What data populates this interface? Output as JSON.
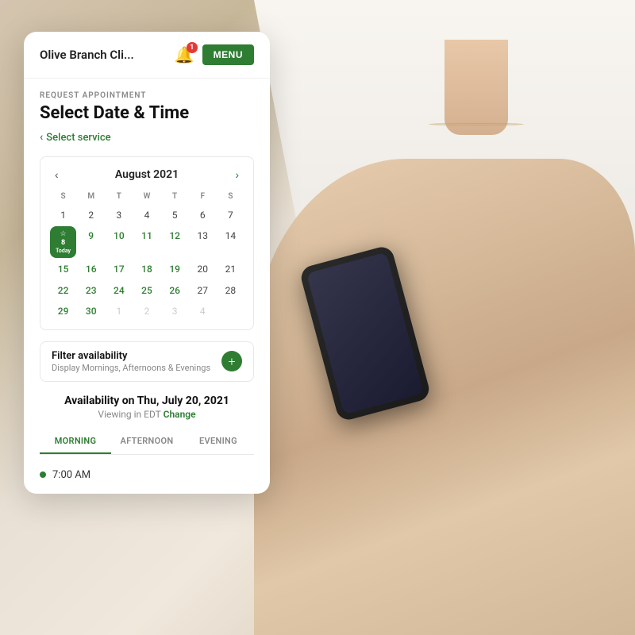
{
  "background": {
    "color1": "#d4c5b0",
    "color2": "#e8d8c4"
  },
  "header": {
    "brand": "Olive Branch Cli...",
    "notification_count": "1",
    "menu_label": "MENU"
  },
  "page": {
    "section_label": "REQUEST APPOINTMENT",
    "title": "Select Date & Time",
    "back_label": "Select service"
  },
  "calendar": {
    "month_year": "August 2021",
    "days_of_week": [
      "S",
      "M",
      "T",
      "W",
      "T",
      "F",
      "S"
    ],
    "weeks": [
      [
        {
          "n": "1",
          "t": ""
        },
        {
          "n": "2",
          "t": ""
        },
        {
          "n": "3",
          "t": ""
        },
        {
          "n": "4",
          "t": ""
        },
        {
          "n": "5",
          "t": ""
        },
        {
          "n": "6",
          "t": ""
        },
        {
          "n": "7",
          "t": ""
        }
      ],
      [
        {
          "n": "8",
          "t": ""
        },
        {
          "n": "9",
          "t": "green"
        },
        {
          "n": "10",
          "t": "green"
        },
        {
          "n": "11",
          "t": "green"
        },
        {
          "n": "12",
          "t": "green"
        },
        {
          "n": "13",
          "t": ""
        }
      ],
      [
        {
          "n": "14",
          "t": ""
        },
        {
          "n": "15",
          "t": "green"
        },
        {
          "n": "16",
          "t": "green"
        },
        {
          "n": "17",
          "t": "green"
        },
        {
          "n": "18",
          "t": "green"
        },
        {
          "n": "19",
          "t": "green"
        },
        {
          "n": "20",
          "t": ""
        }
      ],
      [
        {
          "n": "21",
          "t": ""
        },
        {
          "n": "22",
          "t": "green"
        },
        {
          "n": "23",
          "t": "green"
        },
        {
          "n": "24",
          "t": "green"
        },
        {
          "n": "25",
          "t": "green"
        },
        {
          "n": "26",
          "t": "green"
        },
        {
          "n": "27",
          "t": ""
        }
      ],
      [
        {
          "n": "28",
          "t": ""
        },
        {
          "n": "29",
          "t": "green"
        },
        {
          "n": "30",
          "t": "green"
        },
        {
          "n": "1",
          "t": "other"
        },
        {
          "n": "2",
          "t": "other"
        },
        {
          "n": "3",
          "t": "other"
        },
        {
          "n": "4",
          "t": "other"
        }
      ]
    ],
    "today_day": "8",
    "today_label": "Today"
  },
  "filter": {
    "title": "Filter availability",
    "subtitle": "Display Mornings, Afternoons & Evenings",
    "add_icon": "+"
  },
  "availability": {
    "title": "Availability on Thu, July 20, 2021",
    "subtitle": "Viewing in EDT",
    "change_label": "Change",
    "tabs": [
      "MORNING",
      "AFTERNOON",
      "EVENING"
    ],
    "active_tab": 0,
    "first_slot": "7:00 AM"
  }
}
